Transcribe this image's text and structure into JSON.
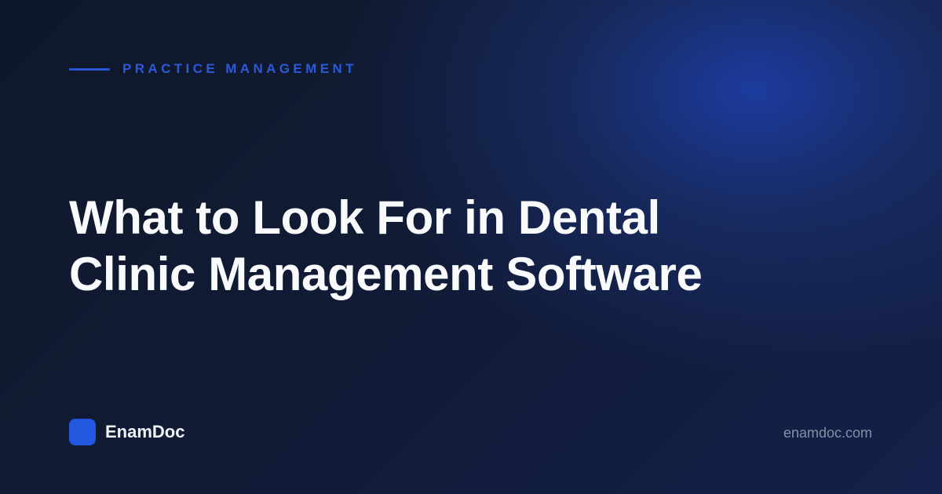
{
  "eyebrow": {
    "label": "PRACTICE MANAGEMENT"
  },
  "headline": {
    "line1": "What to Look For in Dental",
    "line2": "Clinic Management Software"
  },
  "brand": {
    "name": "EnamDoc",
    "logo_color": "#2457e0"
  },
  "footer": {
    "url": "enamdoc.com"
  },
  "colors": {
    "accent": "#2a5ad8",
    "background": "#0f172a",
    "glow": "#1e40af",
    "headline": "#f8fafc",
    "muted": "#8390a6"
  }
}
